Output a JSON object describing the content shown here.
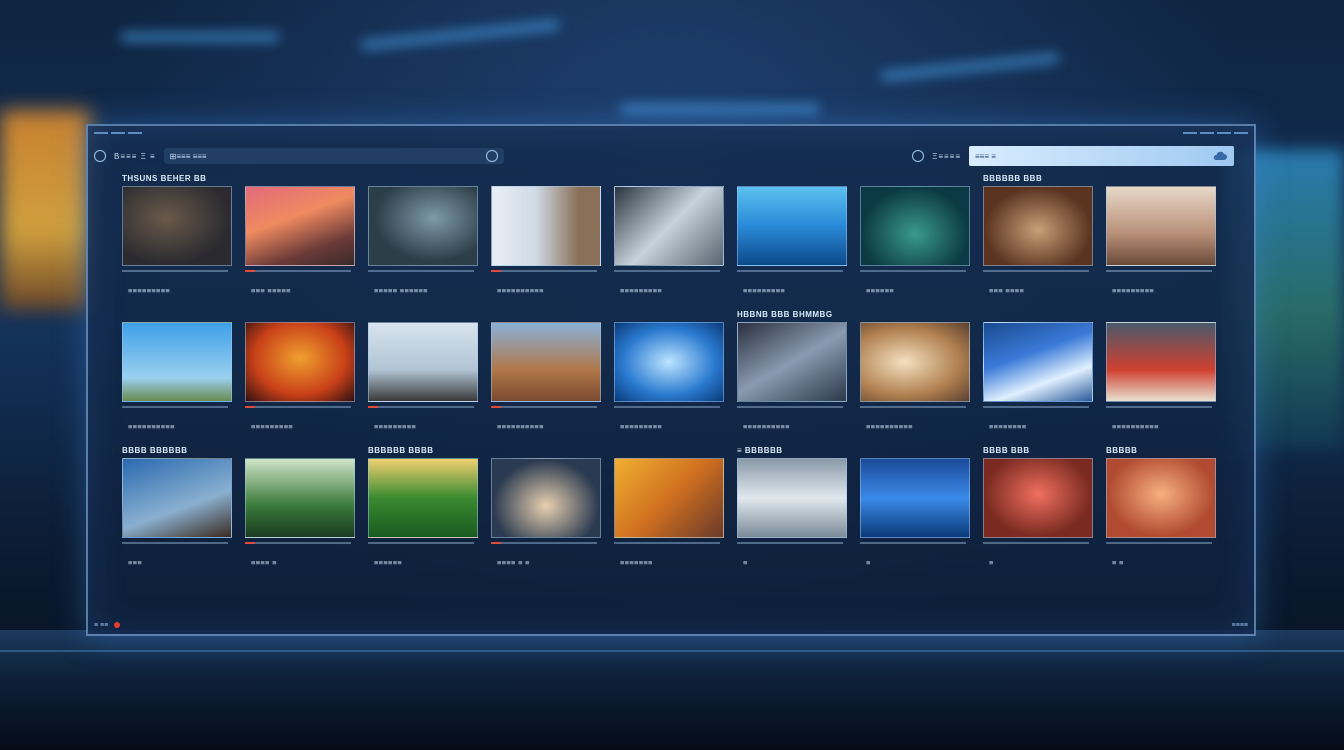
{
  "toolbar": {
    "menu_a": "B≡≡≡ Ξ ≡",
    "url": "⊞≡≡≡ ≡≡≡",
    "signin": "Ξ≡≡≡≡",
    "search_value": "≡≡≡ ≡",
    "search_icon": "cloud-icon"
  },
  "sections": [
    {
      "head": "THSUNS BEHER BB"
    },
    {
      "head": "HBBNB BBB BHMMBG"
    },
    {
      "head": "BBBB BBBBBB"
    }
  ],
  "cards": [
    {
      "head": "THSUNS BEHER BB",
      "cap": "≡≡≡≡≡≡≡≡≡"
    },
    {
      "head": "",
      "cap": "≡≡≡ ≡≡≡≡≡"
    },
    {
      "head": "",
      "cap": "≡≡≡≡≡ ≡≡≡≡≡≡"
    },
    {
      "head": "",
      "cap": "≡≡≡≡≡≡≡≡≡≡"
    },
    {
      "head": "",
      "cap": "≡≡≡≡≡≡≡≡≡"
    },
    {
      "head": "",
      "cap": "≡≡≡≡≡≡≡≡≡"
    },
    {
      "head": "",
      "cap": "≡≡≡≡≡≡"
    },
    {
      "head": "BBBBBB BBB",
      "cap": "≡≡≡ ≡≡≡≡"
    },
    {
      "head": "",
      "cap": "≡≡≡≡≡≡≡≡≡"
    },
    {
      "head": "",
      "cap": "≡≡≡≡≡≡≡≡≡≡"
    },
    {
      "head": "",
      "cap": "≡≡≡≡≡≡≡≡≡"
    },
    {
      "head": "",
      "cap": "≡≡≡≡≡≡≡≡≡"
    },
    {
      "head": "",
      "cap": "≡≡≡≡≡≡≡≡≡≡"
    },
    {
      "head": "",
      "cap": "≡≡≡≡≡≡≡≡≡"
    },
    {
      "head": "HBBNB BBB BHMMBG",
      "cap": "≡≡≡≡≡≡≡≡≡≡"
    },
    {
      "head": "",
      "cap": "≡≡≡≡≡≡≡≡≡≡"
    },
    {
      "head": "",
      "cap": "≡≡≡≡≡≡≡≡"
    },
    {
      "head": "",
      "cap": "≡≡≡≡≡≡≡≡≡≡"
    },
    {
      "head": "BBBB BBBBBB",
      "cap": "≡≡≡"
    },
    {
      "head": "",
      "cap": "≡≡≡≡ ≡"
    },
    {
      "head": "BBBBBB BBBB",
      "cap": "≡≡≡≡≡≡"
    },
    {
      "head": "",
      "cap": "≡≡≡≡ ≡ ≡"
    },
    {
      "head": "",
      "cap": "≡≡≡≡≡≡≡"
    },
    {
      "head": "≡ BBBBBB",
      "cap": "≡"
    },
    {
      "head": "",
      "cap": "≡"
    },
    {
      "head": "BBBB BBB",
      "cap": "≡"
    },
    {
      "head": "BBBBB",
      "cap": "≡ ≡"
    }
  ],
  "footer": {
    "left": "≡ ≡≡",
    "right": "≡≡≡≡"
  },
  "colors": {
    "accent": "#4fb0ff",
    "alert": "#e0402a"
  }
}
